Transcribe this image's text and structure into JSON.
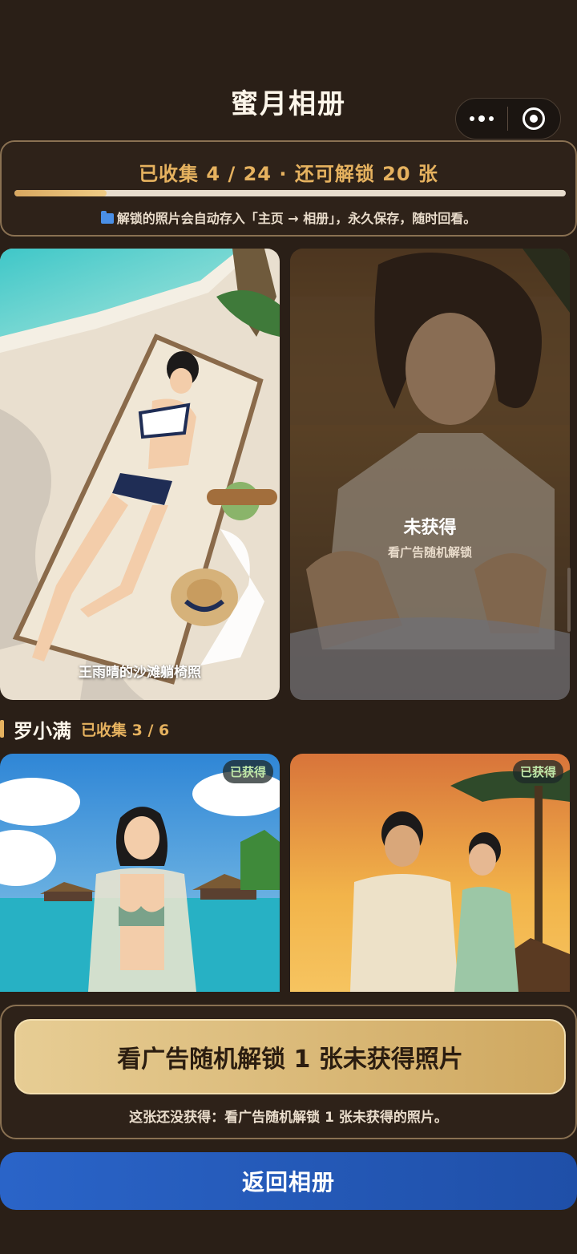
{
  "header": {
    "title": "蜜月相册"
  },
  "progress": {
    "text": "已收集 4 / 24 · 还可解锁 20 张",
    "fraction": 0.1667,
    "note": "解锁的照片会自动存入「主页 → 相册」，永久保存，随时回看。",
    "accent": "#e6b25f"
  },
  "photos_top": [
    {
      "caption": "王雨晴的沙滩躺椅照"
    },
    {
      "locked_title": "未获得",
      "locked_sub": "看广告随机解锁"
    }
  ],
  "section": {
    "name": "罗小满",
    "count": "已收集 3 / 6"
  },
  "photos_bottom": [
    {
      "badge": "已获得"
    },
    {
      "badge": "已获得"
    }
  ],
  "actions": {
    "unlock_label": "看广告随机解锁 1 张未获得照片",
    "unlock_hint": "这张还没获得：看广告随机解锁 1 张未获得的照片。",
    "back_label": "返回相册"
  },
  "icons": {
    "more": "more-dots-icon",
    "close": "target-close-icon",
    "folder": "folder-icon"
  }
}
